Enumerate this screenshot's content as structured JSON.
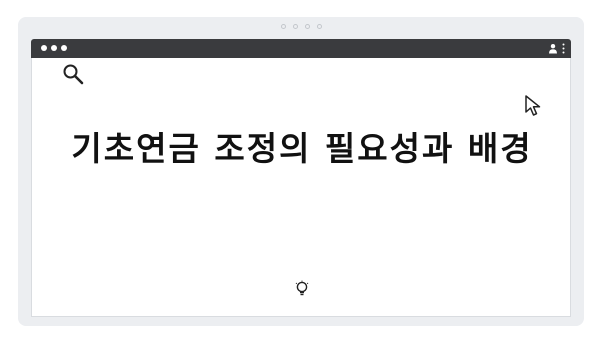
{
  "browser": {
    "title_bar": {
      "window_controls": [
        "dot",
        "dot",
        "dot"
      ],
      "icons": [
        "user-icon",
        "kebab-menu-icon"
      ]
    }
  },
  "page": {
    "title": "기초연금 조정의 필요성과 배경",
    "icons": [
      "search-icon",
      "cursor-icon",
      "lightbulb-icon"
    ]
  },
  "colors": {
    "title_bar": "#3a3b3e",
    "frame": "#eceef1",
    "content_bg": "#ffffff",
    "text": "#111111"
  }
}
